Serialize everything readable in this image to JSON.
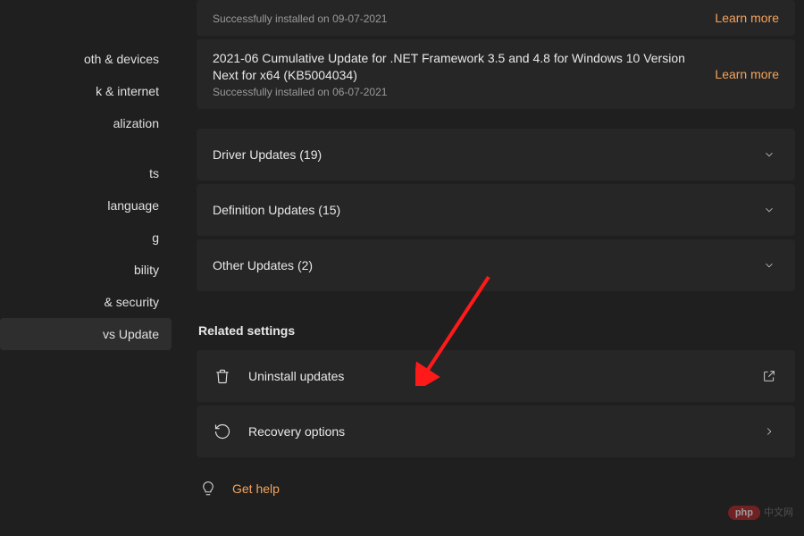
{
  "sidebar": {
    "items": [
      {
        "label": "oth & devices"
      },
      {
        "label": "k & internet"
      },
      {
        "label": "alization"
      },
      {
        "label": ""
      },
      {
        "label": "ts"
      },
      {
        "label": "language"
      },
      {
        "label": "g"
      },
      {
        "label": "bility"
      },
      {
        "label": "& security"
      },
      {
        "label": "vs Update"
      }
    ],
    "active_index": 9
  },
  "updates": [
    {
      "title": "",
      "subtitle": "Successfully installed on 09-07-2021",
      "learn_more": "Learn more"
    },
    {
      "title": "2021-06 Cumulative Update for .NET Framework 3.5 and 4.8 for Windows 10 Version Next for x64 (KB5004034)",
      "subtitle": "Successfully installed on 06-07-2021",
      "learn_more": "Learn more"
    }
  ],
  "expanders": [
    {
      "label": "Driver Updates (19)"
    },
    {
      "label": "Definition Updates (15)"
    },
    {
      "label": "Other Updates (2)"
    }
  ],
  "related": {
    "header": "Related settings",
    "uninstall": "Uninstall updates",
    "recovery": "Recovery options"
  },
  "help": {
    "label": "Get help"
  },
  "watermark": {
    "pill": "php",
    "text": "中文网"
  }
}
